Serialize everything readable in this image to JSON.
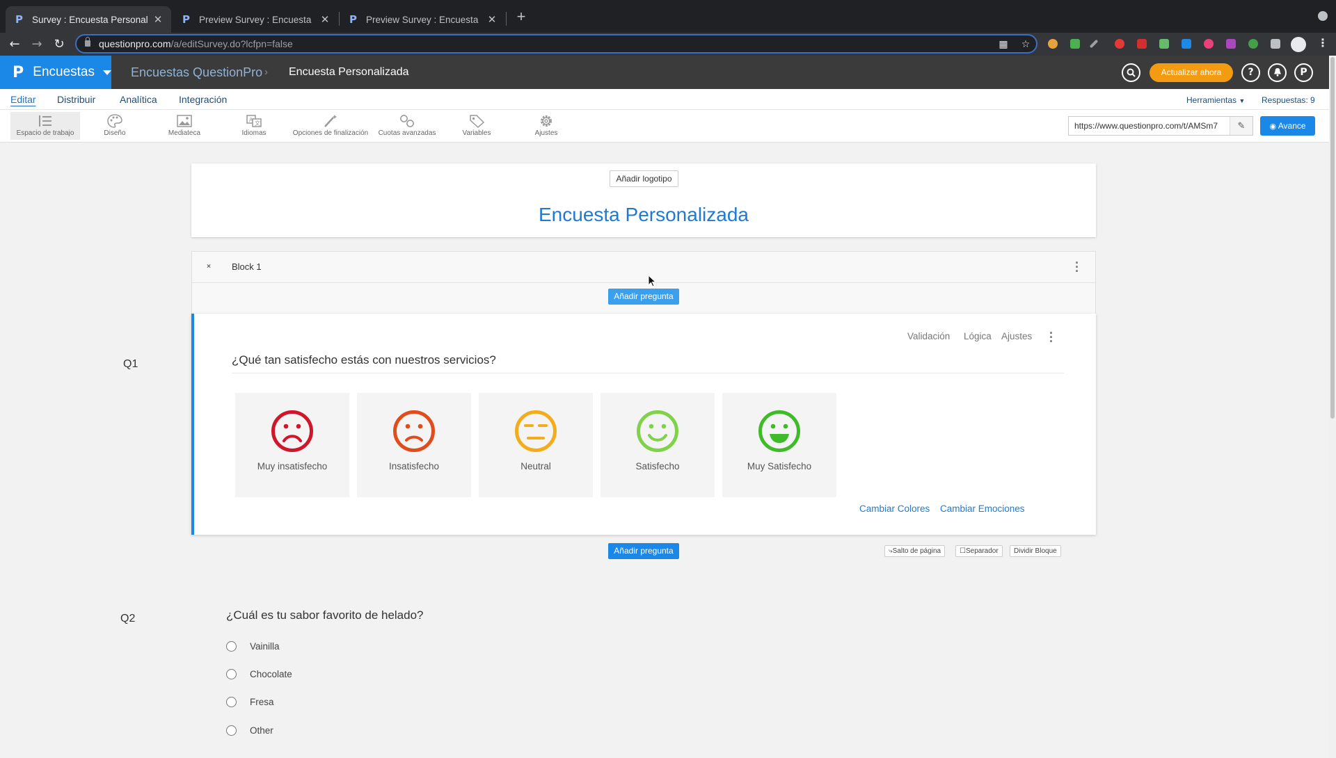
{
  "browser": {
    "tabs": [
      {
        "title": "Survey : Encuesta Personalizada",
        "active": true
      },
      {
        "title": "Preview Survey : Encuesta Personalizada",
        "active": false
      },
      {
        "title": "Preview Survey : Encuesta Personalizada",
        "active": false
      }
    ],
    "url_host": "questionpro.com",
    "url_path": "/a/editSurvey.do?lcfpn=false"
  },
  "app": {
    "brand_name": "Encuestas",
    "breadcrumb_parent": "Encuestas QuestionPro",
    "breadcrumb_separator": "›",
    "breadcrumb_current": "Encuesta Personalizada",
    "upgrade_label": "Actualizar ahora",
    "help_label": "?",
    "accent_color": "#1b87e6",
    "upgrade_color": "#f39c12"
  },
  "menu": {
    "items": [
      "Editar",
      "Distribuir",
      "Analítica",
      "Integración"
    ],
    "tools_label": "Herramientas",
    "responses_label": "Respuestas: 9"
  },
  "toolbar": {
    "items": [
      {
        "label": "Espacio de trabajo",
        "icon": "workspace-icon"
      },
      {
        "label": "Diseño",
        "icon": "palette-icon"
      },
      {
        "label": "Mediateca",
        "icon": "image-icon"
      },
      {
        "label": "Idiomas",
        "icon": "translate-icon"
      },
      {
        "label": "Opciones de finalización",
        "icon": "magic-wand-icon"
      },
      {
        "label": "Cuotas avanzadas",
        "icon": "link-icon"
      },
      {
        "label": "Variables",
        "icon": "tag-icon"
      },
      {
        "label": "Ajustes",
        "icon": "gear-icon"
      }
    ],
    "survey_url": "https://www.questionpro.com/t/AMSm7",
    "preview_label": "Avance"
  },
  "survey": {
    "add_logo_label": "Añadir logotipo",
    "title": "Encuesta Personalizada",
    "block_name": "Block 1",
    "add_question_label": "Añadir pregunta",
    "page_break_label": "Salto de página",
    "separator_label": "Separador",
    "split_block_label": "Dividir Bloque"
  },
  "q1": {
    "number": "Q1",
    "title": "¿Qué tan satisfecho estás con nuestros servicios?",
    "tools": [
      "Validación",
      "Lógica",
      "Ajustes"
    ],
    "options": [
      {
        "label": "Muy insatisfecho",
        "mood": "very-sad",
        "color": "#d0162b"
      },
      {
        "label": "Insatisfecho",
        "mood": "sad",
        "color": "#e04d1c"
      },
      {
        "label": "Neutral",
        "mood": "neutral",
        "color": "#f2ac1c"
      },
      {
        "label": "Satisfecho",
        "mood": "happy",
        "color": "#7fd24a"
      },
      {
        "label": "Muy Satisfecho",
        "mood": "very-happy",
        "color": "#3fbb2a"
      }
    ],
    "change_colors_label": "Cambiar Colores",
    "change_emotions_label": "Cambiar Emociones"
  },
  "q2": {
    "number": "Q2",
    "title": "¿Cuál es tu sabor favorito de helado?",
    "options": [
      "Vainilla",
      "Chocolate",
      "Fresa",
      "Other"
    ]
  }
}
